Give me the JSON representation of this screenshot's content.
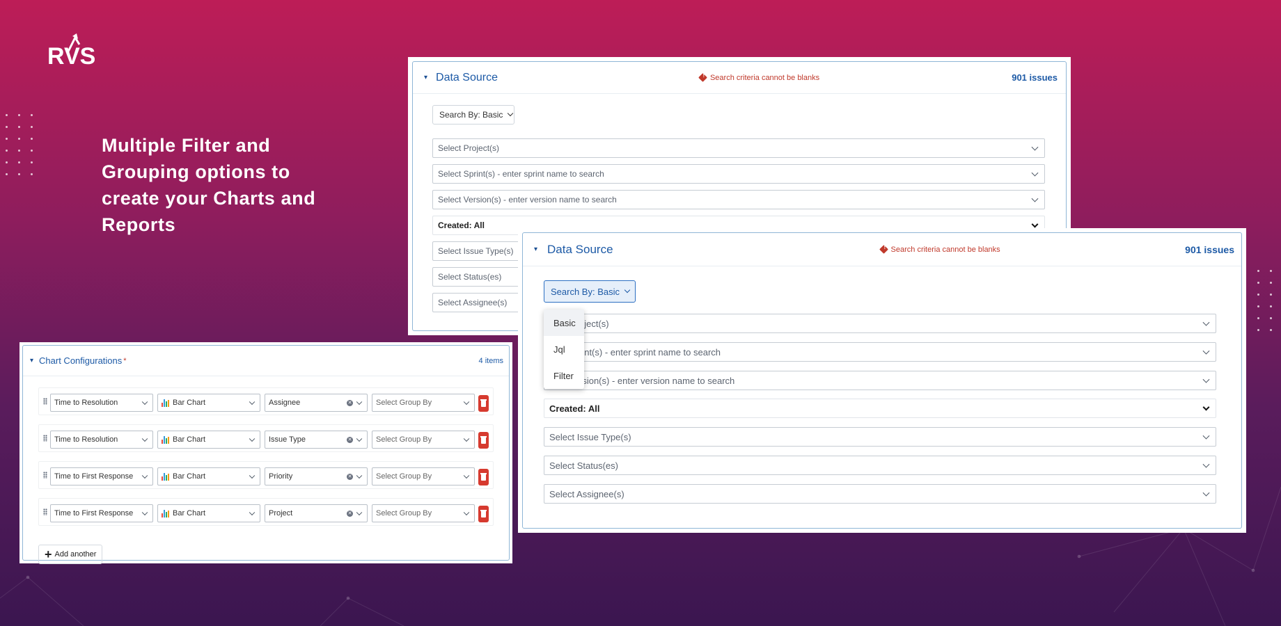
{
  "brand": {
    "logo_text": "RVS"
  },
  "headline": "Multiple Filter and Grouping options to create your Charts and Reports",
  "colors": {
    "accent_blue": "#1d5aa6",
    "error_red": "#c0392b",
    "delete_red": "#d63a2f"
  },
  "data_source_back": {
    "title": "Data Source",
    "warning": "Search criteria cannot be blanks",
    "issue_count": "901 issues",
    "search_by": "Search By: Basic",
    "fields": [
      "Select Project(s)",
      "Select Sprint(s) - enter sprint name to search",
      "Select Version(s) - enter version name to search",
      "Created: All",
      "Select Issue Type(s)",
      "Select Status(es)",
      "Select Assignee(s)"
    ]
  },
  "data_source_front": {
    "title": "Data Source",
    "warning": "Search criteria cannot be blanks",
    "issue_count": "901 issues",
    "search_by": "Search By: Basic",
    "dropdown_options": [
      "Basic",
      "Jql",
      "Filter"
    ],
    "fields_partial": [
      "oject(s)",
      "rint(s) - enter sprint name to search",
      "rsion(s) - enter version name to search"
    ],
    "created": "Created: All",
    "issue_type": "Select Issue Type(s)",
    "status": "Select Status(es)",
    "assignee": "Select Assignee(s)"
  },
  "chart_config": {
    "title": "Chart Configurations",
    "required_mark": "*",
    "item_count": "4 items",
    "rows": [
      {
        "metric": "Time to Resolution",
        "chart": "Bar Chart",
        "field": "Assignee",
        "group_by": "Select Group By"
      },
      {
        "metric": "Time to Resolution",
        "chart": "Bar Chart",
        "field": "Issue Type",
        "group_by": "Select Group By"
      },
      {
        "metric": "Time to First Response",
        "chart": "Bar Chart",
        "field": "Priority",
        "group_by": "Select Group By"
      },
      {
        "metric": "Time to First Response",
        "chart": "Bar Chart",
        "field": "Project",
        "group_by": "Select Group By"
      }
    ],
    "add_label": "Add another"
  }
}
